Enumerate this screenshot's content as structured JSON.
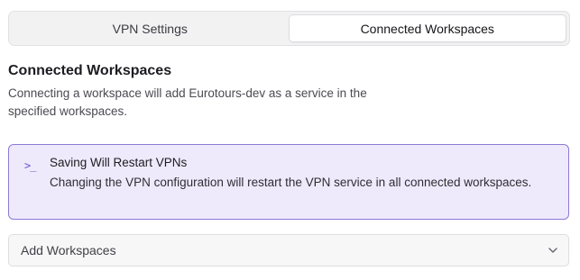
{
  "tabs": [
    {
      "label": "VPN Settings",
      "active": false
    },
    {
      "label": "Connected Workspaces",
      "active": true
    }
  ],
  "section": {
    "title": "Connected Workspaces",
    "description": "Connecting a workspace will add Eurotours-dev as a service in the specified workspaces."
  },
  "alert": {
    "icon": "terminal-icon",
    "icon_glyph": ">_",
    "title": "Saving Will Restart VPNs",
    "body": "Changing the VPN configuration will restart the VPN service in all connected workspaces.",
    "accent_color": "#8d79d6",
    "background_color": "#efeafb"
  },
  "add_workspaces": {
    "label": "Add Workspaces",
    "icon": "chevron-down-icon"
  }
}
